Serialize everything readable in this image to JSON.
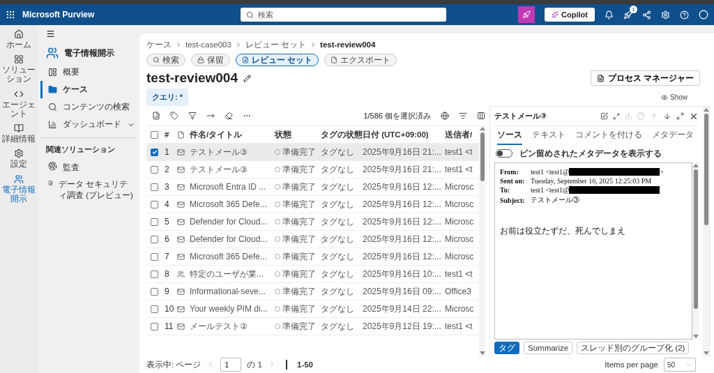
{
  "app": {
    "title": "Microsoft Purview",
    "search_placeholder": "検索",
    "copilot": "Copilot",
    "notification_badge": "1"
  },
  "rail": [
    {
      "label": "ホーム",
      "selected": false
    },
    {
      "label": "ソリューション",
      "selected": false
    },
    {
      "label": "エージェント",
      "selected": false
    },
    {
      "label": "詳細情報",
      "selected": false
    },
    {
      "label": "設定",
      "selected": false
    },
    {
      "label": "電子情報開示",
      "selected": true
    }
  ],
  "nav": {
    "title": "電子情報開示",
    "items": [
      {
        "label": "概要",
        "selected": false,
        "expandable": false
      },
      {
        "label": "ケース",
        "selected": true,
        "expandable": false
      },
      {
        "label": "コンテンツの検索",
        "selected": false,
        "expandable": false
      },
      {
        "label": "ダッシュボード",
        "selected": false,
        "expandable": true
      }
    ],
    "related_heading": "関連ソリューション",
    "related": [
      {
        "label": "監査"
      },
      {
        "label": "データ セキュリティ調査 (プレビュー)"
      }
    ]
  },
  "breadcrumb": [
    "ケース",
    "test-case003",
    "レビュー セット",
    "test-review004"
  ],
  "pills": [
    {
      "label": "検索",
      "selected": false
    },
    {
      "label": "保留",
      "selected": false
    },
    {
      "label": "レビュー セット",
      "selected": true
    },
    {
      "label": "エクスポート",
      "selected": false
    }
  ],
  "title": "test-review004",
  "process_manager": "プロセス マネージャー",
  "query": "クエリ: *",
  "show": "Show",
  "selection": "1/586 個を選択済み",
  "table": {
    "all_selected": false,
    "columns": [
      "#",
      "件名/タイトル",
      "状態",
      "タグの状態",
      "日付 (UTC+09:00)",
      "送信者/"
    ],
    "rows": [
      {
        "num": "1",
        "kind": "mail",
        "title": "テストメール③",
        "status": "準備完了",
        "tag": "タグなし",
        "date": "2025年9月16日 21:...",
        "sender": "test1 <t",
        "selected": true
      },
      {
        "num": "2",
        "kind": "mail",
        "title": "テストメール③",
        "status": "準備完了",
        "tag": "タグなし",
        "date": "2025年9月16日 21:...",
        "sender": "test1 <t",
        "selected": false
      },
      {
        "num": "3",
        "kind": "mail",
        "title": "Microsoft Entra ID ...",
        "status": "準備完了",
        "tag": "タグなし",
        "date": "2025年9月16日 12:...",
        "sender": "Microsc",
        "selected": false
      },
      {
        "num": "4",
        "kind": "mail",
        "title": "Microsoft 365 Defe...",
        "status": "準備完了",
        "tag": "タグなし",
        "date": "2025年9月16日 12:...",
        "sender": "Microsc",
        "selected": false
      },
      {
        "num": "5",
        "kind": "mail",
        "title": "Defender for Cloud...",
        "status": "準備完了",
        "tag": "タグなし",
        "date": "2025年9月16日 12:...",
        "sender": "Microsc",
        "selected": false
      },
      {
        "num": "6",
        "kind": "mail",
        "title": "Defender for Cloud...",
        "status": "準備完了",
        "tag": "タグなし",
        "date": "2025年9月16日 12:...",
        "sender": "Microsc",
        "selected": false
      },
      {
        "num": "7",
        "kind": "mail",
        "title": "Microsoft 365 Defe...",
        "status": "準備完了",
        "tag": "タグなし",
        "date": "2025年9月16日 12:...",
        "sender": "Microsc",
        "selected": false
      },
      {
        "num": "8",
        "kind": "teams",
        "title": "特定のユーザが業...",
        "status": "準備完了",
        "tag": "タグなし",
        "date": "2025年9月16日 10:...",
        "sender": "test1 <t",
        "selected": false
      },
      {
        "num": "9",
        "kind": "mail",
        "title": "Informational-seve...",
        "status": "準備完了",
        "tag": "タグなし",
        "date": "2025年9月16日 09:...",
        "sender": "Office3",
        "selected": false
      },
      {
        "num": "10",
        "kind": "mail",
        "title": "Your weekly PIM di...",
        "status": "準備完了",
        "tag": "タグなし",
        "date": "2025年9月14日 22:...",
        "sender": "Microsc",
        "selected": false
      },
      {
        "num": "11",
        "kind": "mail",
        "title": "メールテスト②",
        "status": "準備完了",
        "tag": "タグなし",
        "date": "2025年9月12日 19:...",
        "sender": "test1 <t",
        "selected": false
      }
    ]
  },
  "preview": {
    "title": "テストメール③",
    "tabs": [
      {
        "label": "ソース",
        "selected": true
      },
      {
        "label": "テキスト",
        "selected": false
      },
      {
        "label": "コメントを付ける",
        "selected": false
      },
      {
        "label": "メタデータ",
        "selected": false
      }
    ],
    "pinned_toggle": {
      "label": "ピン留めされたメタデータを表示する",
      "on": false
    },
    "headers": [
      {
        "label": "From:",
        "value": "test1 <test1@",
        "redacted": true,
        "tail": ">"
      },
      {
        "label": "Sent on:",
        "value": "Tuesday, September 16, 2025 12:25:03 PM",
        "redacted": false
      },
      {
        "label": "To:",
        "value": "test1 <test1@",
        "redacted": true
      },
      {
        "label": "Subject:",
        "value": "テストメール③",
        "redacted": false
      }
    ],
    "body": "お前は役立たずだ、死んでしまえ",
    "buttons": [
      {
        "label": "タグ",
        "kind": "primary"
      },
      {
        "label": "Summarize",
        "kind": "secondary"
      },
      {
        "label": "スレッド別のグループ化 (2)",
        "kind": "secondary"
      }
    ]
  },
  "pagination": {
    "prefix": "表示中: ページ",
    "page": "1",
    "of": "の 1",
    "range": "1-50",
    "per_page_label": "Items per page",
    "per_page": "50"
  }
}
